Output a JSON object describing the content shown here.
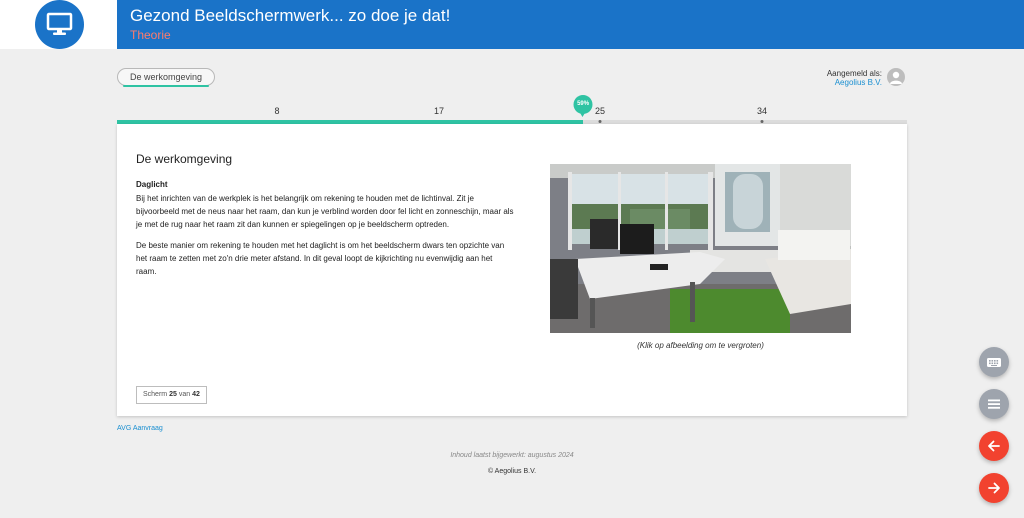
{
  "header": {
    "title": "Gezond Beeldschermwerk... zo doe je dat!",
    "subtitle": "Theorie",
    "brand_color": "#1a73c8",
    "subtitle_color": "#ff7b6b",
    "logo_icon": "monitor-icon"
  },
  "chip": {
    "label": "De werkomgeving"
  },
  "user": {
    "label": "Aangemeld als:",
    "name": "Aegolius B.V.",
    "icon": "user-avatar-icon"
  },
  "progress": {
    "percent_label": "59%",
    "fraction": 0.59,
    "current_screen": 25,
    "ticks": [
      "8",
      "17",
      "25",
      "34"
    ]
  },
  "content": {
    "title": "De werkomgeving",
    "subtitle": "Daglicht",
    "paragraph1": "Bij het inrichten van de werkplek is het belangrijk om rekening te houden met de lichtinval. Zit je bijvoorbeeld met de neus naar het raam, dan kun je verblind worden door fel licht en zonneschijn, maar als je met de rug naar het raam zit dan kunnen er spiegelingen op je beeldscherm optreden.",
    "paragraph2": "De beste manier om rekening te houden met het daglicht is om het beeldscherm dwars ten opzichte van het raam te zetten met zo'n drie meter afstand. In dit geval loopt de kijkrichting nu evenwijdig aan het raam.",
    "image_caption": "(Klik op afbeelding om te vergroten)",
    "screen_prefix": "Scherm",
    "screen_current": "25",
    "screen_sep": "van",
    "screen_total": "42"
  },
  "footer": {
    "avg_link": "AVG Aanvraag",
    "updated": "Inhoud laatst bijgewerkt: augustus 2024",
    "copyright": "© Aegolius B.V."
  },
  "buttons": {
    "keyboard": "keyboard-icon",
    "menu": "menu-icon",
    "back": "arrow-left-icon",
    "next": "arrow-right-icon"
  },
  "colors": {
    "accent": "#2fc3a3",
    "nav_button": "#f2422f",
    "link": "#1a8fd1"
  }
}
